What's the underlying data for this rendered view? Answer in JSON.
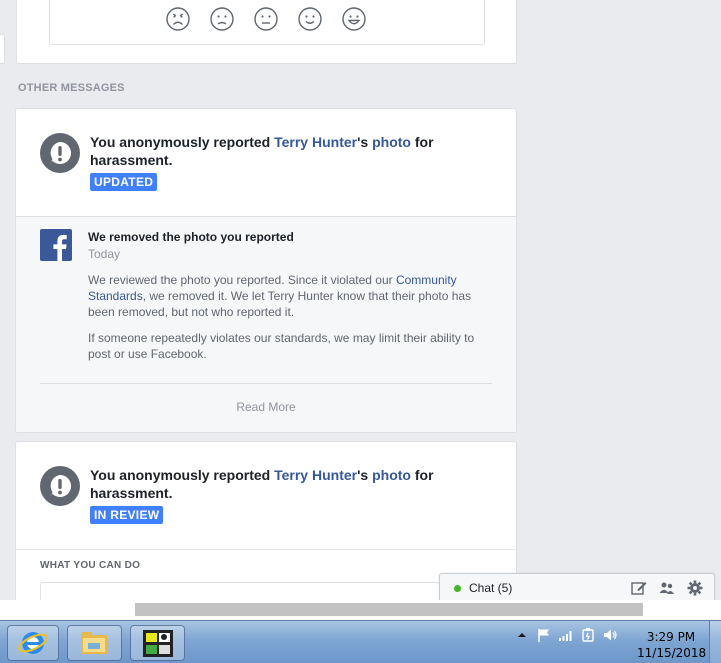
{
  "rating_card": {
    "faces": [
      "very-dissatisfied-face-icon",
      "dissatisfied-face-icon",
      "neutral-face-icon",
      "satisfied-face-icon",
      "very-satisfied-face-icon"
    ]
  },
  "other_messages": {
    "title": "OTHER MESSAGES"
  },
  "report1": {
    "prefix": "You anonymously reported ",
    "person": "Terry Hunter",
    "possessive": "'s ",
    "item": "photo",
    "suffix": " for harassment.",
    "status": "UPDATED",
    "update": {
      "title": "We removed the photo you reported",
      "time": "Today",
      "p1_start": "We reviewed the photo you reported. Since it violated our ",
      "p1_link": "Community Standards",
      "p1_end": ", we removed it. We let Terry Hunter know that their photo has been removed, but not who reported it.",
      "p2": "If someone repeatedly violates our standards, we may limit their ability to post or use Facebook.",
      "read_more": "Read More"
    }
  },
  "report2": {
    "prefix": "You anonymously reported ",
    "person": "Terry Hunter",
    "possessive": "'s ",
    "item": "photo",
    "suffix": " for harassment.",
    "status": "IN REVIEW",
    "what_you_can_do": "WHAT YOU CAN DO"
  },
  "chat": {
    "label": "Chat (5)",
    "status_color": "#42b72a"
  },
  "taskbar": {
    "time": "3:29 PM",
    "date": "11/15/2018"
  },
  "colors": {
    "link": "#365899",
    "badge": "#4080ff",
    "background": "#e9ebee"
  }
}
